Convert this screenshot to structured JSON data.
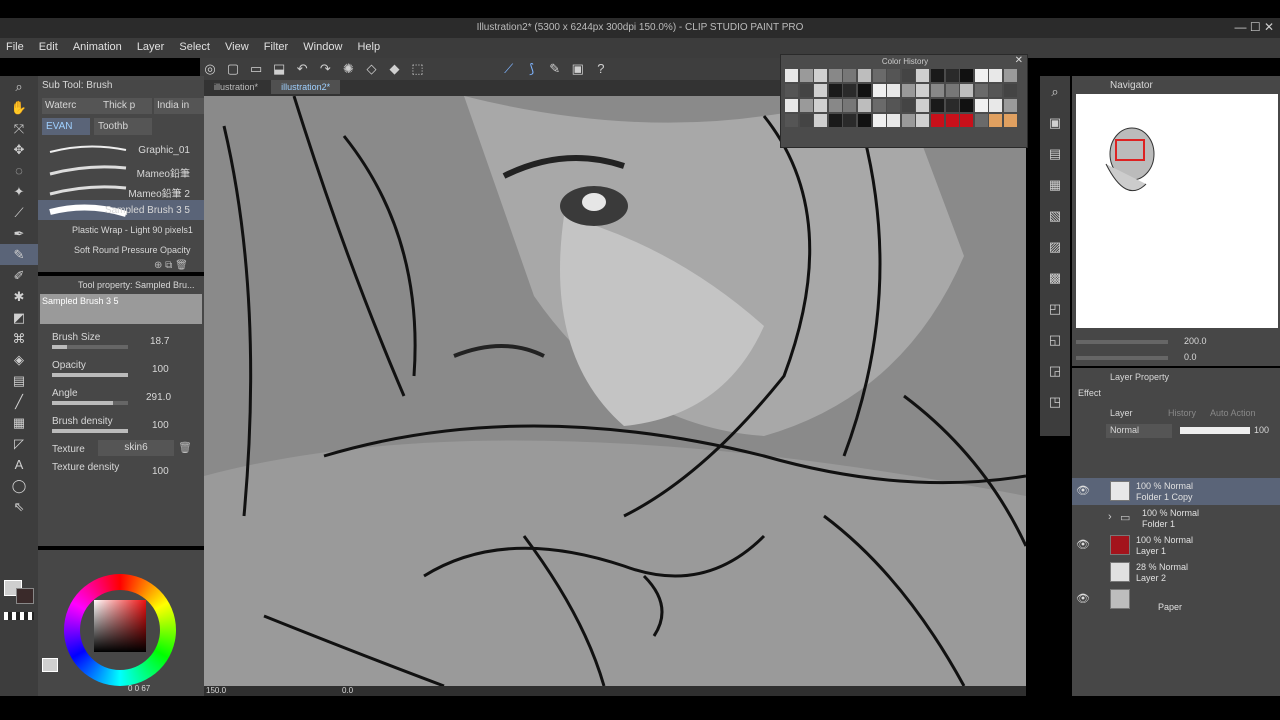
{
  "window": {
    "title": "Illustration2* (5300 x 6244px 300dpi 150.0%) - CLIP STUDIO PAINT PRO"
  },
  "menu": [
    "File",
    "Edit",
    "Animation",
    "Layer",
    "Select",
    "View",
    "Filter",
    "Window",
    "Help"
  ],
  "tabs": [
    {
      "label": "illustration*",
      "active": false
    },
    {
      "label": "illustration2*",
      "active": true
    }
  ],
  "subtool": {
    "title": "Sub Tool: Brush",
    "tabs": [
      "Waterc",
      "Thick p",
      "India in",
      "EVAN",
      "Toothb"
    ],
    "brushes": [
      "Graphic_01",
      "Mameo鉛筆",
      "Mameo鉛筆 2",
      "Sampled Brush 3 5",
      "Plastic Wrap - Light 90 pixels1",
      "Soft Round Pressure Opacity"
    ]
  },
  "toolprop": {
    "title": "Tool property: Sampled Bru...",
    "preview_name": "Sampled Brush 3 5",
    "rows": [
      {
        "label": "Brush Size",
        "value": "18.7"
      },
      {
        "label": "Opacity",
        "value": "100"
      },
      {
        "label": "Angle",
        "value": "291.0"
      },
      {
        "label": "Brush density",
        "value": "100"
      }
    ],
    "texture_label": "Texture",
    "texture_value": "skin6",
    "texture_density_label": "Texture density",
    "texture_density_value": "100"
  },
  "color_wheel": {
    "readout": "0 0 67"
  },
  "color_history": {
    "title": "Color History"
  },
  "navigator": {
    "title": "Navigator",
    "zoom": "200.0",
    "angle": "0.0"
  },
  "layer_property": {
    "title": "Layer Property",
    "effect_label": "Effect"
  },
  "layer_panel": {
    "tabs": [
      "Layer",
      "History",
      "Auto Action"
    ],
    "blend_mode": "Normal",
    "opacity": "100",
    "layers": [
      {
        "mode": "100 % Normal",
        "name": "Folder 1 Copy",
        "selected": true,
        "thumb_color": "#e8e8e8"
      },
      {
        "mode": "100 % Normal",
        "name": "Folder 1",
        "selected": false,
        "thumb_color": "#cfcfcf"
      },
      {
        "mode": "100 % Normal",
        "name": "Layer 1",
        "selected": false,
        "thumb_color": "#a3141c"
      },
      {
        "mode": "28 % Normal",
        "name": "Layer 2",
        "selected": false,
        "thumb_color": "#e0e0e0"
      },
      {
        "mode": "",
        "name": "Paper",
        "selected": false,
        "thumb_color": "#bdbdbd"
      }
    ]
  },
  "status": {
    "zoom": "150.0",
    "angle": "0.0"
  },
  "colors": {
    "accent": "#5a6478",
    "canvas_bg": "#8c8c8c",
    "red": "#a3141c"
  }
}
